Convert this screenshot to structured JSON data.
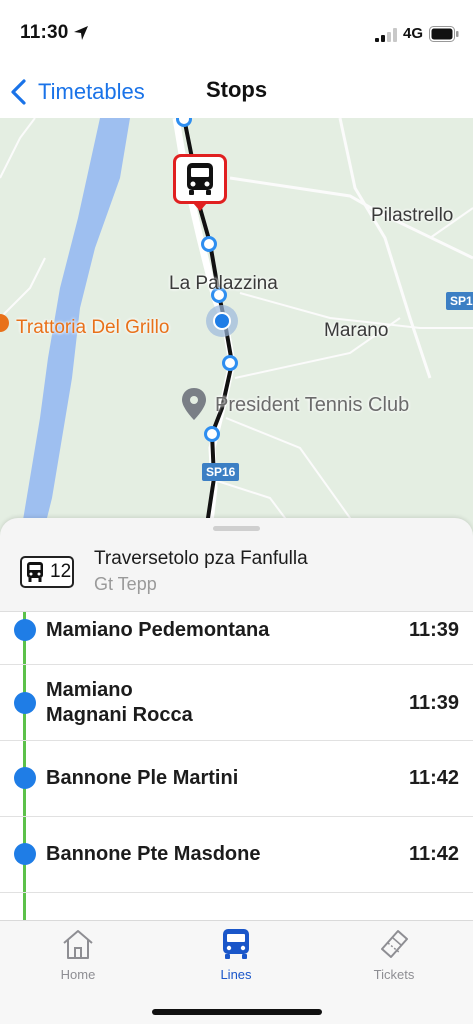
{
  "status_bar": {
    "time": "11:30",
    "network": "4G"
  },
  "nav": {
    "back_label": "Timetables",
    "title": "Stops"
  },
  "map": {
    "places": [
      "Pilastrello",
      "La Palazzina",
      "Marano"
    ],
    "poi_restaurant": "Trattoria Del Grillo",
    "poi_club": "President Tennis Club",
    "road_sp16": "SP16",
    "road_sp1": "SP1"
  },
  "line": {
    "number": "12",
    "destination": "Traversetolo pza Fanfulla",
    "operator": "Gt Tepp"
  },
  "stops": [
    {
      "name_lines": [
        "Mamiano Pedemontana"
      ],
      "time": "11:39"
    },
    {
      "name_lines": [
        "Mamiano",
        "Magnani Rocca"
      ],
      "time": "11:39"
    },
    {
      "name_lines": [
        "Bannone Ple Martini"
      ],
      "time": "11:42"
    },
    {
      "name_lines": [
        "Bannone Pte Masdone"
      ],
      "time": "11:42"
    }
  ],
  "tabs": [
    {
      "label": "Home",
      "icon": "home-icon",
      "active": false
    },
    {
      "label": "Lines",
      "icon": "bus-icon",
      "active": true
    },
    {
      "label": "Tickets",
      "icon": "ticket-icon",
      "active": false
    }
  ],
  "colors": {
    "accent": "#1a73e8",
    "active_tab": "#1a56c9",
    "route": "#5cc14a",
    "stop_dot": "#1f7de6",
    "marker": "#e02020"
  }
}
